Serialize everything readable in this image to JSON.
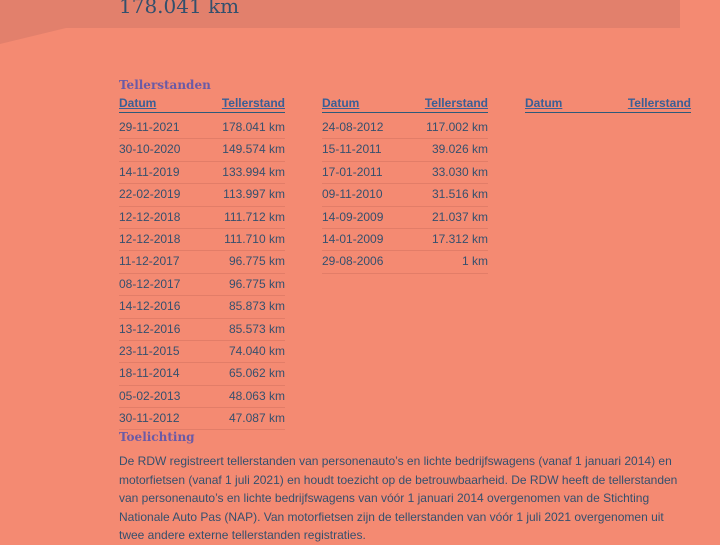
{
  "header": {
    "mileage": "178.041 km"
  },
  "tellerstanden": {
    "title": "Tellerstanden",
    "col_date": "Datum",
    "col_value": "Tellerstand",
    "columns": [
      [
        {
          "date": "29-11-2021",
          "value": "178.041 km"
        },
        {
          "date": "30-10-2020",
          "value": "149.574 km"
        },
        {
          "date": "14-11-2019",
          "value": "133.994 km"
        },
        {
          "date": "22-02-2019",
          "value": "113.997 km"
        },
        {
          "date": "12-12-2018",
          "value": "111.712 km"
        },
        {
          "date": "12-12-2018",
          "value": "111.710 km"
        },
        {
          "date": "11-12-2017",
          "value": "96.775 km"
        },
        {
          "date": "08-12-2017",
          "value": "96.775 km"
        },
        {
          "date": "14-12-2016",
          "value": "85.873 km"
        },
        {
          "date": "13-12-2016",
          "value": "85.573 km"
        },
        {
          "date": "23-11-2015",
          "value": "74.040 km"
        },
        {
          "date": "18-11-2014",
          "value": "65.062 km"
        },
        {
          "date": "05-02-2013",
          "value": "48.063 km"
        },
        {
          "date": "30-11-2012",
          "value": "47.087 km"
        }
      ],
      [
        {
          "date": "24-08-2012",
          "value": "117.002 km"
        },
        {
          "date": "15-11-2011",
          "value": "39.026 km"
        },
        {
          "date": "17-01-2011",
          "value": "33.030 km"
        },
        {
          "date": "09-11-2010",
          "value": "31.516 km"
        },
        {
          "date": "14-09-2009",
          "value": "21.037 km"
        },
        {
          "date": "14-01-2009",
          "value": "17.312 km"
        },
        {
          "date": "29-08-2006",
          "value": "1 km"
        }
      ],
      []
    ]
  },
  "toelichting": {
    "title": "Toelichting",
    "text": "De RDW registreert tellerstanden van personenauto’s en lichte bedrijfswagens (vanaf 1 januari 2014) en motorfietsen (vanaf 1 juli 2021) en houdt toezicht op de betrouwbaarheid. De RDW heeft de tellerstanden van personenauto’s en lichte bedrijfswagens van vóór 1 januari 2014 overgenomen van de Stichting Nationale Auto Pas (NAP). Van motorfietsen zijn de tellerstanden van vóór 1 juli 2021 overgenomen uit twee andere externe tellerstanden registraties."
  }
}
